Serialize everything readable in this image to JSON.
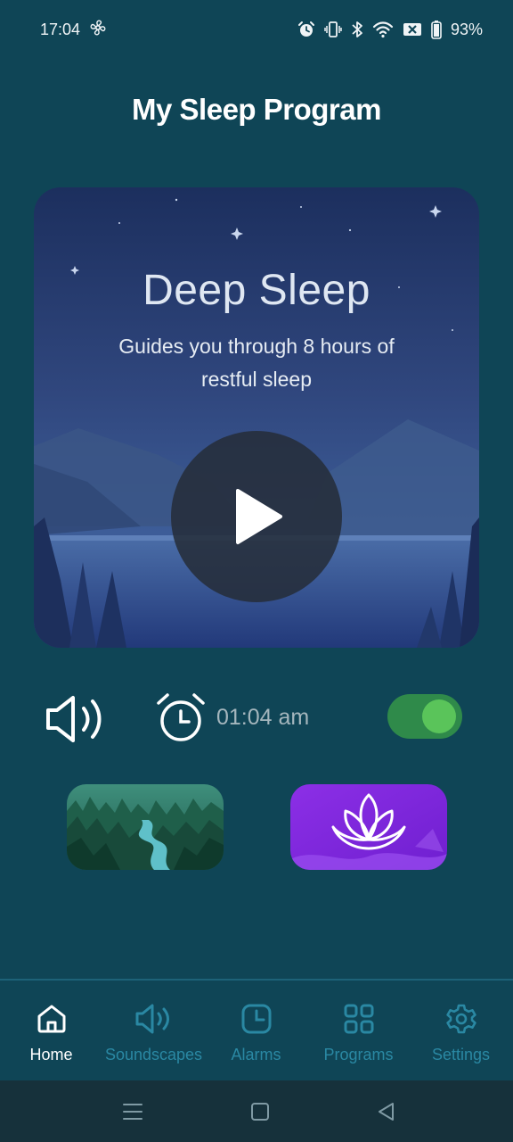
{
  "status_bar": {
    "time": "17:04",
    "battery": "93%",
    "icons": [
      "fan-icon",
      "alarm-icon",
      "vibrate-icon",
      "bluetooth-icon",
      "wifi-icon",
      "no-sim-icon",
      "battery-icon"
    ]
  },
  "page": {
    "title": "My Sleep Program"
  },
  "hero": {
    "title": "Deep Sleep",
    "subtitle": "Guides you through 8 hours of restful sleep",
    "play_icon": "play-icon"
  },
  "controls": {
    "volume_icon": "volume-icon",
    "alarm_icon": "alarm-clock-icon",
    "alarm_time": "01:04 am",
    "alarm_enabled": true
  },
  "tiles": [
    {
      "name": "nature-river-tile"
    },
    {
      "name": "lotus-meditation-tile"
    }
  ],
  "nav": {
    "items": [
      {
        "label": "Home",
        "icon": "home-icon",
        "active": true
      },
      {
        "label": "Soundscapes",
        "icon": "speaker-icon",
        "active": false
      },
      {
        "label": "Alarms",
        "icon": "clock-icon",
        "active": false
      },
      {
        "label": "Programs",
        "icon": "grid-icon",
        "active": false
      },
      {
        "label": "Settings",
        "icon": "gear-icon",
        "active": false
      }
    ]
  },
  "colors": {
    "background": "#0f4556",
    "accent": "#2a88a3",
    "toggle_on": "#5ac45a",
    "lotus_tile": "#8a2be2"
  }
}
